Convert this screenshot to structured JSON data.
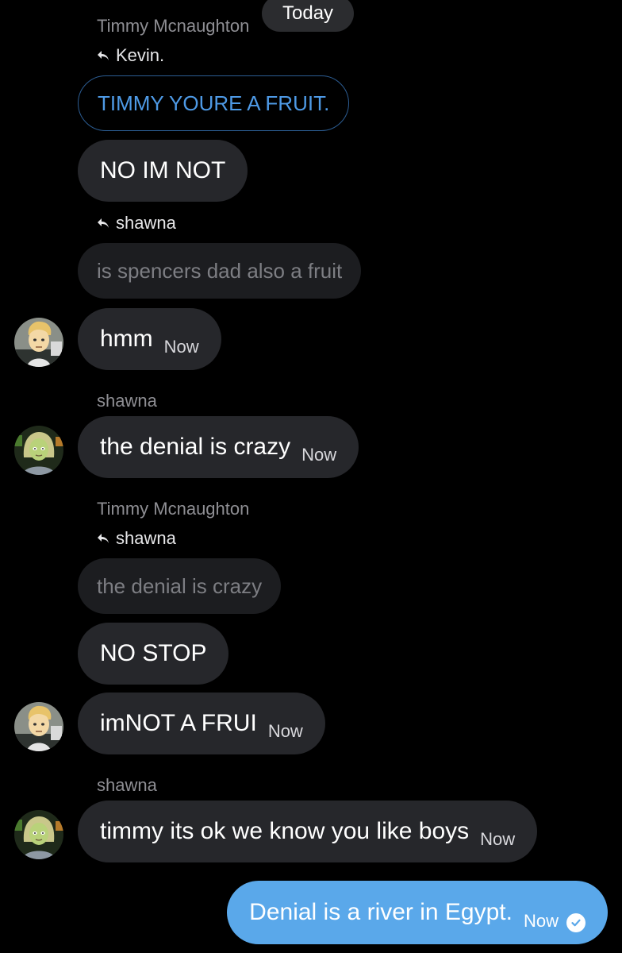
{
  "date_label": "Today",
  "messages": [
    {
      "sender": "Timmy Mcnaughton",
      "reply_to": "Kevin.",
      "quoted": "TIMMY YOURE A FRUIT.",
      "text": "NO IM NOT"
    },
    {
      "reply_to": "shawna",
      "quoted": "is spencers dad also a fruit",
      "text": "hmm",
      "time": "Now"
    },
    {
      "sender": "shawna",
      "text": "the denial is crazy",
      "time": "Now"
    },
    {
      "sender": "Timmy Mcnaughton",
      "reply_to": "shawna",
      "quoted": "the denial is crazy",
      "text": "NO STOP"
    },
    {
      "text": "imNOT A FRUI",
      "time": "Now"
    },
    {
      "sender": "shawna",
      "text": "timmy its ok we know you like boys",
      "time": "Now"
    },
    {
      "text": "Denial is a river in Egypt.",
      "time": "Now",
      "status": "read-check-icon"
    }
  ],
  "colors": {
    "background": "#000000",
    "bubble": "#26272b",
    "outgoing_bubble": "#5aa8ea",
    "quote_outline": "#2c5d93",
    "quote_text_blue": "#4e9ae6"
  }
}
